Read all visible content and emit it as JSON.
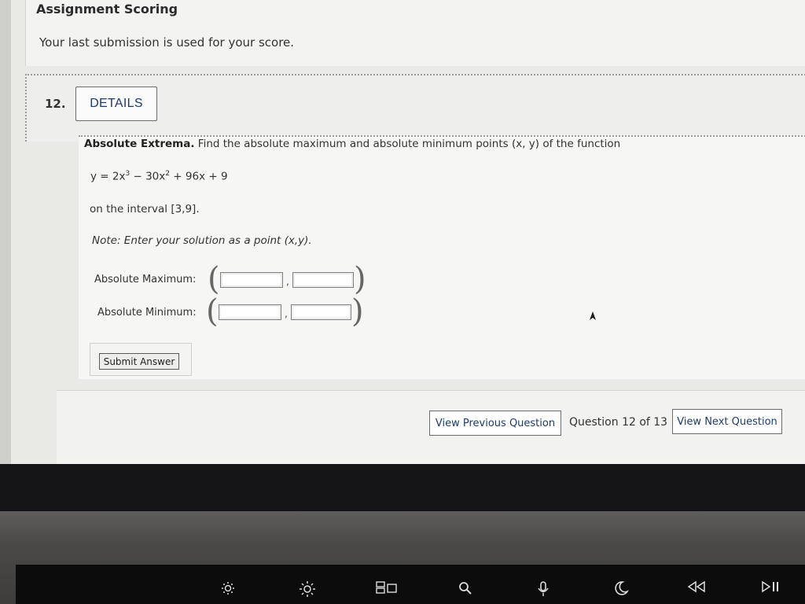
{
  "scoring": {
    "title": "Assignment Scoring",
    "text": "Your last submission is used for your score."
  },
  "question": {
    "number": "12.",
    "details_label": "DETAILS",
    "heading": "Absolute Extrema.",
    "prompt": "Find the absolute maximum and absolute minimum points (x, y) of the function",
    "equation": {
      "y": "y = 2x",
      "exp1": "3",
      "mid": " − 30x",
      "exp2": "2",
      "rest": " + 96x + 9"
    },
    "interval": "on the interval [3,9].",
    "note": "Note: Enter your solution as a point (x,y).",
    "max_label": "Absolute Maximum:",
    "min_label": "Absolute Minimum:",
    "comma": ",",
    "submit_label": "Submit Answer"
  },
  "navigation": {
    "prev_label": "View Previous Question",
    "status": "Question 12 of 13",
    "next_label": "View Next Question"
  },
  "touchbar": {
    "icons": [
      "brightness-down-icon",
      "brightness-up-icon",
      "mission-control-icon",
      "spotlight-search-icon",
      "dictation-icon",
      "do-not-disturb-icon",
      "rewind-icon",
      "play-pause-icon"
    ]
  }
}
